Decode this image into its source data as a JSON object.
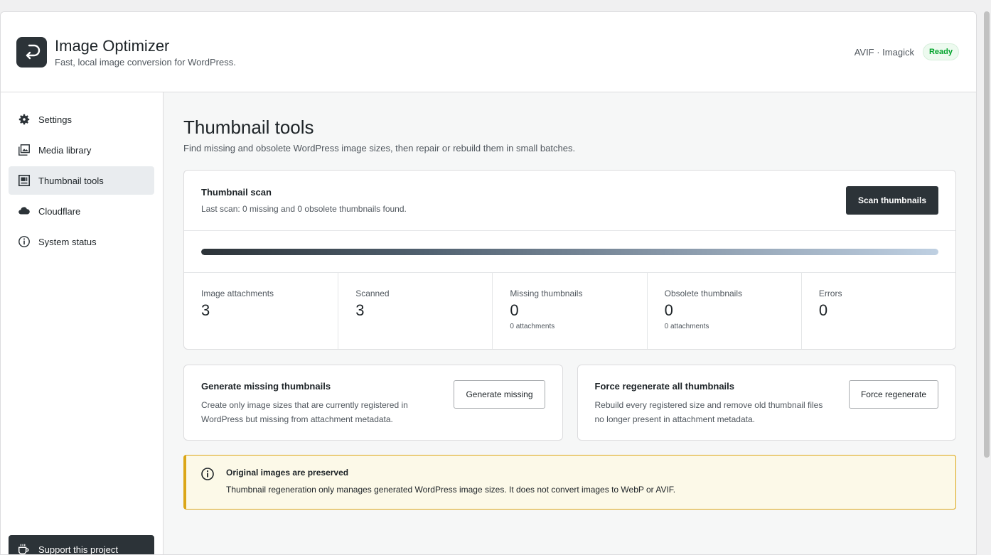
{
  "app": {
    "title": "Image Optimizer",
    "subtitle": "Fast, local image conversion for WordPress.",
    "engine": "AVIF · Imagick",
    "status": "Ready",
    "logo_icon": "return-arrow-icon"
  },
  "sidebar": {
    "items": [
      {
        "label": "Settings",
        "icon": "gear-icon",
        "active": false
      },
      {
        "label": "Media library",
        "icon": "images-icon",
        "active": false
      },
      {
        "label": "Thumbnail tools",
        "icon": "thumbnail-icon",
        "active": true
      },
      {
        "label": "Cloudflare",
        "icon": "cloud-icon",
        "active": false
      },
      {
        "label": "System status",
        "icon": "info-icon",
        "active": false
      }
    ],
    "support": {
      "label": "Support this project",
      "icon": "coffee-icon"
    }
  },
  "main": {
    "title": "Thumbnail tools",
    "subtitle": "Find missing and obsolete WordPress image sizes, then repair or rebuild them in small batches."
  },
  "scan": {
    "title": "Thumbnail scan",
    "description": "Last scan: 0 missing and 0 obsolete thumbnails found.",
    "button": "Scan thumbnails",
    "progress": 1.0
  },
  "stats": [
    {
      "label": "Image attachments",
      "value": "3",
      "note": ""
    },
    {
      "label": "Scanned",
      "value": "3",
      "note": ""
    },
    {
      "label": "Missing thumbnails",
      "value": "0",
      "note": "0 attachments"
    },
    {
      "label": "Obsolete thumbnails",
      "value": "0",
      "note": "0 attachments"
    },
    {
      "label": "Errors",
      "value": "0",
      "note": ""
    }
  ],
  "actions": {
    "generate": {
      "title": "Generate missing thumbnails",
      "description": "Create only image sizes that are currently registered in WordPress but missing from attachment metadata.",
      "button": "Generate missing"
    },
    "force": {
      "title": "Force regenerate all thumbnails",
      "description": "Rebuild every registered size and remove old thumbnail files no longer present in attachment metadata.",
      "button": "Force regenerate"
    }
  },
  "notice": {
    "title": "Original images are preserved",
    "description": "Thumbnail regeneration only manages generated WordPress image sizes. It does not convert images to WebP or AVIF.",
    "icon": "info-icon"
  },
  "colors": {
    "accent_dark": "#2c3338",
    "ready_green": "#00a32a",
    "notice_border": "#dba617",
    "notice_bg": "#fcf9e8"
  }
}
